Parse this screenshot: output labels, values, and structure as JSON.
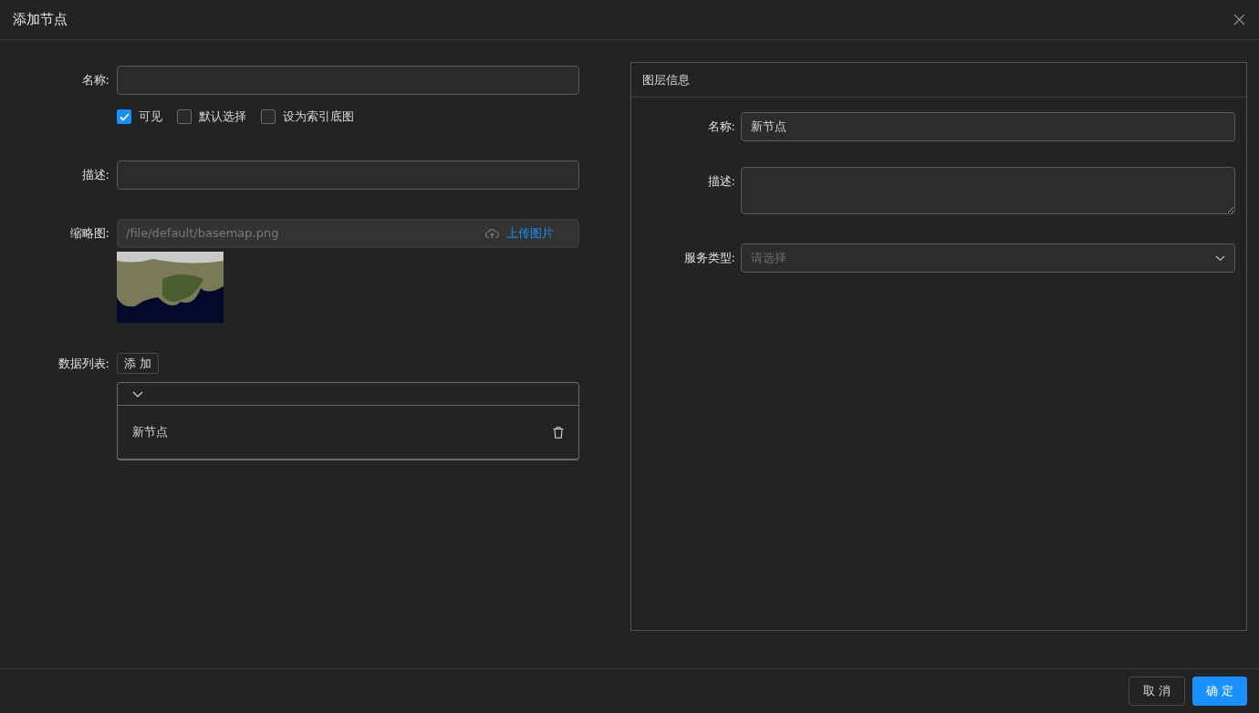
{
  "dialog": {
    "title": "添加节点"
  },
  "form": {
    "name": {
      "label": "名称:"
    },
    "checkboxes": [
      {
        "label": "可见",
        "checked": true
      },
      {
        "label": "默认选择",
        "checked": false
      },
      {
        "label": "设为索引底图",
        "checked": false
      }
    ],
    "description": {
      "label": "描述:"
    },
    "thumbnail": {
      "label": "缩略图:",
      "value": "/file/default/basemap.png",
      "upload_label": "上传图片"
    },
    "data_list": {
      "label": "数据列表:",
      "add_button": "添 加",
      "items": [
        {
          "label": "新节点",
          "expanded": true
        }
      ]
    }
  },
  "layer_panel": {
    "title": "图层信息",
    "name": {
      "label": "名称:",
      "value": "新节点"
    },
    "description": {
      "label": "描述:"
    },
    "service_type": {
      "label": "服务类型:",
      "placeholder": "请选择"
    }
  },
  "footer": {
    "buttons": [
      {
        "label": "取 消",
        "kind": "default"
      },
      {
        "label": "确 定",
        "kind": "primary"
      }
    ]
  }
}
